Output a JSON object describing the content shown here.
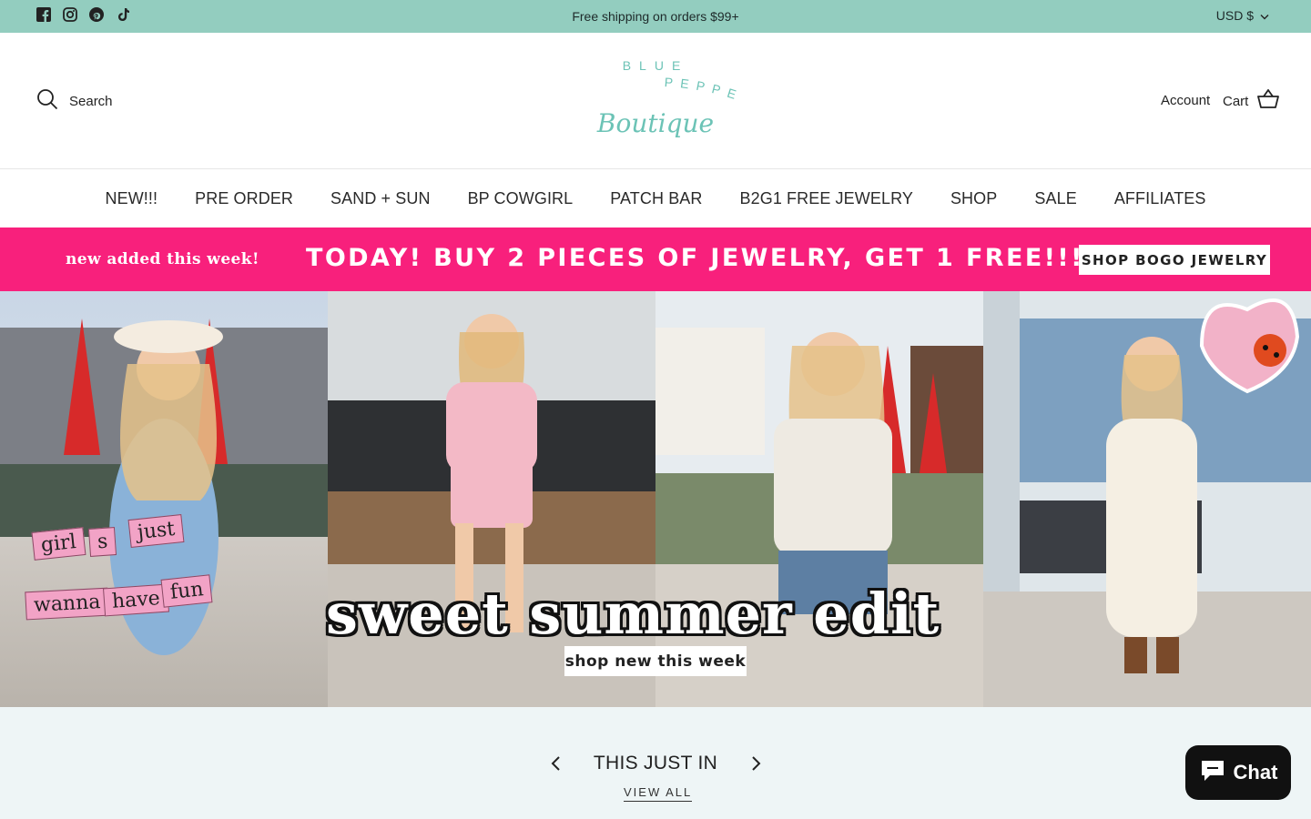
{
  "announcement": {
    "text": "Free shipping on orders $99+",
    "currency": "USD $",
    "social_icons": [
      "facebook-icon",
      "instagram-icon",
      "pinterest-icon",
      "tiktok-icon"
    ]
  },
  "header": {
    "search_label": "Search",
    "logo": {
      "line1": "BLUE",
      "line2": "PEPPERMINT",
      "line3": "Boutique"
    },
    "account_label": "Account",
    "cart_label": "Cart"
  },
  "nav": {
    "items": [
      "NEW!!!",
      "PRE ORDER",
      "SAND + SUN",
      "BP COWGIRL",
      "PATCH BAR",
      "B2G1 FREE JEWELRY",
      "SHOP",
      "SALE",
      "AFFILIATES"
    ]
  },
  "promo": {
    "left_text": "new added this week!",
    "main_text": "TODAY! BUY 2 PIECES OF JEWELRY, GET 1 FREE!!!",
    "button": "SHOP BOGO JEWELRY"
  },
  "hero": {
    "stickers": [
      "girl",
      "s",
      "just",
      "wanna",
      "have",
      "fun"
    ],
    "title": "sweet summer edit",
    "subtitle": "shop new this week"
  },
  "section": {
    "title": "THIS JUST IN",
    "view_all": "VIEW ALL"
  },
  "chat": {
    "label": "Chat"
  },
  "colors": {
    "announcement_bg": "#93cdbf",
    "promo_bg": "#f8207c",
    "lower_bg": "#eef5f6",
    "logo": "#6cc3b6"
  }
}
